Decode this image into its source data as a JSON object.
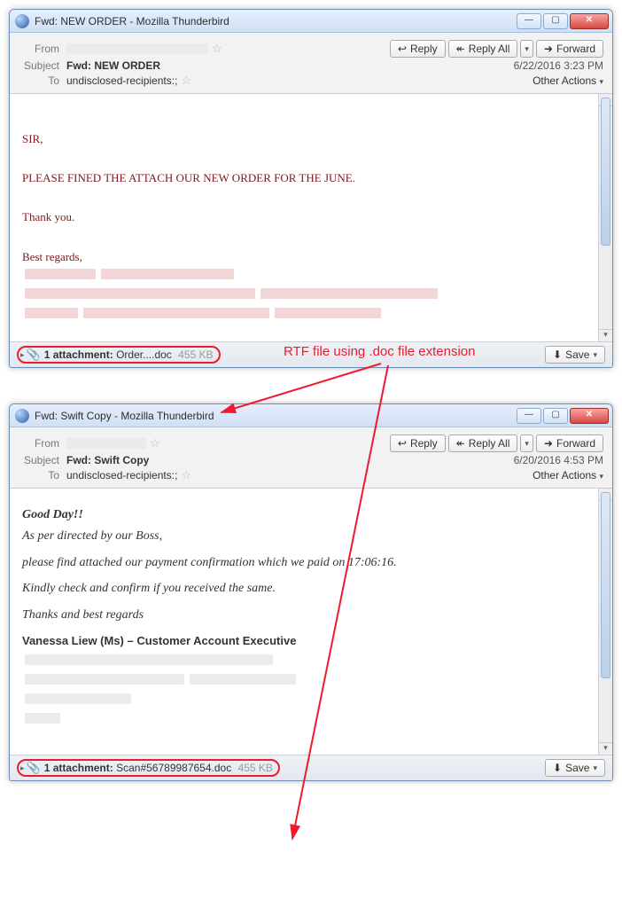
{
  "annotation_label": "RTF file using .doc file extension",
  "win1": {
    "title": "Fwd: NEW ORDER - Mozilla Thunderbird",
    "from_label": "From",
    "subject_label": "Subject",
    "subject_value": "Fwd: NEW ORDER",
    "to_label": "To",
    "to_value": "undisclosed-recipients:;",
    "date": "6/22/2016 3:23 PM",
    "reply": "Reply",
    "reply_all": "Reply All",
    "forward": "Forward",
    "other_actions": "Other Actions",
    "body": {
      "l1": "SIR,",
      "l2": "PLEASE FINED THE ATTACH OUR NEW ORDER FOR  THE JUNE.",
      "l3": "Thank you.",
      "l4": "Best regards,"
    },
    "attach": {
      "count_label": "1 attachment:",
      "name": "Order....doc",
      "size": "455 KB",
      "save": "Save"
    }
  },
  "win2": {
    "title": "Fwd: Swift Copy - Mozilla Thunderbird",
    "from_label": "From",
    "subject_label": "Subject",
    "subject_value": "Fwd: Swift Copy",
    "to_label": "To",
    "to_value": "undisclosed-recipients:;",
    "date": "6/20/2016 4:53 PM",
    "reply": "Reply",
    "reply_all": "Reply All",
    "forward": "Forward",
    "other_actions": "Other Actions",
    "body": {
      "l1": "Good Day!!",
      "l2": "As per directed by our Boss,",
      "l3": "please find attached our payment confirmation which we paid on 17:06:16.",
      "l4": "Kindly check and confirm if you received the same.",
      "l5": "Thanks and best regards",
      "sig": "Vanessa Liew (Ms) – Customer Account Executive"
    },
    "attach": {
      "count_label": "1 attachment:",
      "name": "Scan#56789987654.doc",
      "size": "455 KB",
      "save": "Save"
    }
  }
}
